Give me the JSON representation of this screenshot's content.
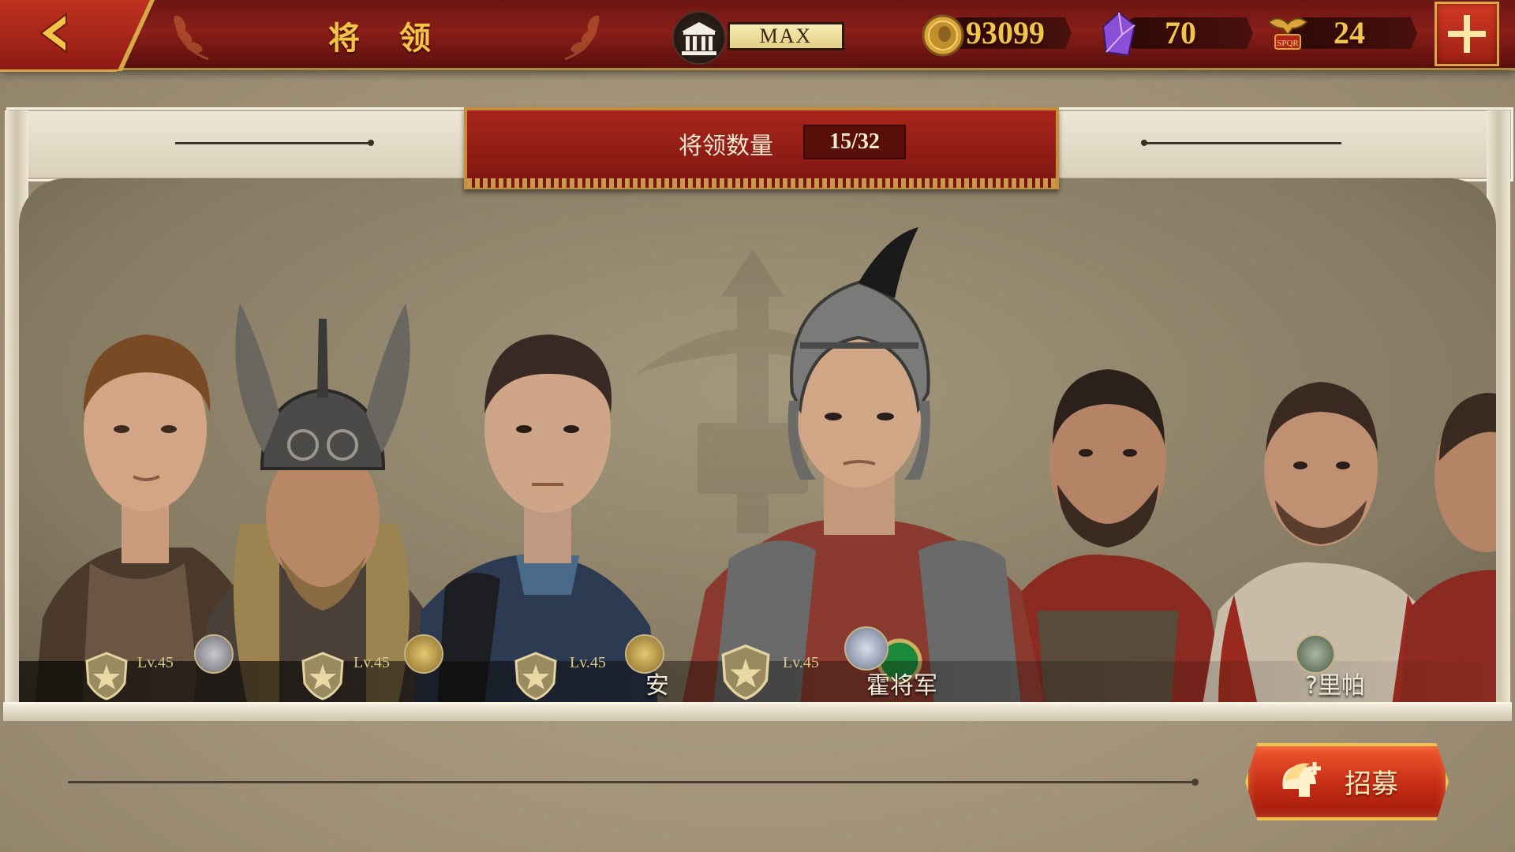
{
  "header": {
    "title": "将 领",
    "vip_label": "MAX",
    "gold": "93099",
    "gems": "70",
    "spqr_tokens": "24"
  },
  "banner": {
    "label": "将领数量",
    "count": "15/32"
  },
  "generals": [
    {
      "level": "Lv.45",
      "name": ""
    },
    {
      "level": "Lv.45",
      "name": ""
    },
    {
      "level": "Lv.45",
      "name": "安"
    },
    {
      "level": "Lv.45",
      "name": "霍将军"
    },
    {
      "level": "",
      "name": ""
    },
    {
      "level": "",
      "name": "?里帕"
    },
    {
      "level": "",
      "name": ""
    }
  ],
  "recruit": {
    "label": "招募"
  },
  "icons": {
    "back": "chevron-left-icon",
    "vip": "temple-icon",
    "gold": "gold-coin-icon",
    "gem": "purple-gem-icon",
    "spqr": "spqr-eagle-icon",
    "add": "plus-icon",
    "recruit": "spartan-helmet-icon"
  },
  "colors": {
    "accent": "#8a1f19",
    "gold": "#f0c64a",
    "frame": "#eee7d5"
  }
}
